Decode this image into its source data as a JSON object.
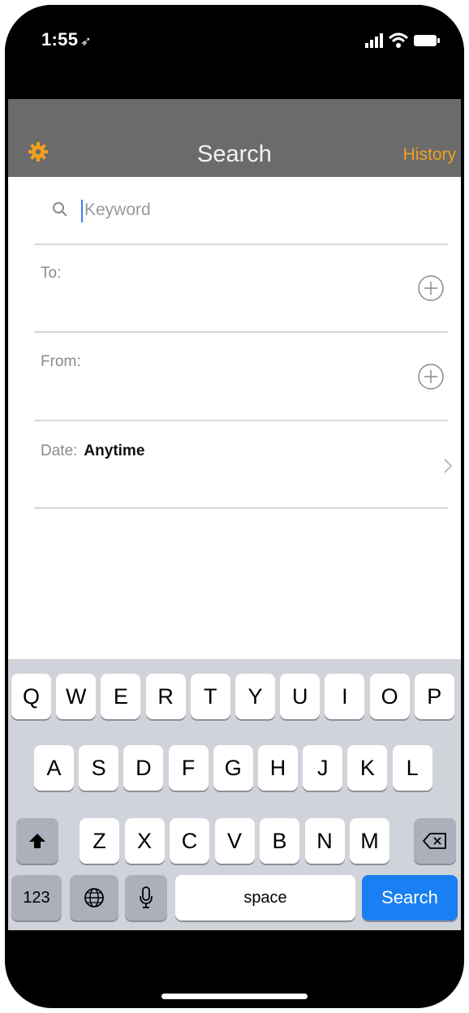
{
  "status_bar": {
    "time": "1:55"
  },
  "nav": {
    "title": "Search",
    "history_label": "History"
  },
  "search": {
    "placeholder": "Keyword"
  },
  "fields": {
    "to_label": "To:",
    "from_label": "From:",
    "date_label": "Date:",
    "date_value": "Anytime"
  },
  "keyboard": {
    "row1": [
      "Q",
      "W",
      "E",
      "R",
      "T",
      "Y",
      "U",
      "I",
      "O",
      "P"
    ],
    "row2": [
      "A",
      "S",
      "D",
      "F",
      "G",
      "H",
      "J",
      "K",
      "L"
    ],
    "row3": [
      "Z",
      "X",
      "C",
      "V",
      "B",
      "N",
      "M"
    ],
    "numbers_label": "123",
    "space_label": "space",
    "search_label": "Search"
  },
  "colors": {
    "accent": "#f0a020",
    "nav_bg": "#6b6b6b",
    "keyboard_bg": "#d0d3da",
    "search_key": "#1a7ff2"
  }
}
